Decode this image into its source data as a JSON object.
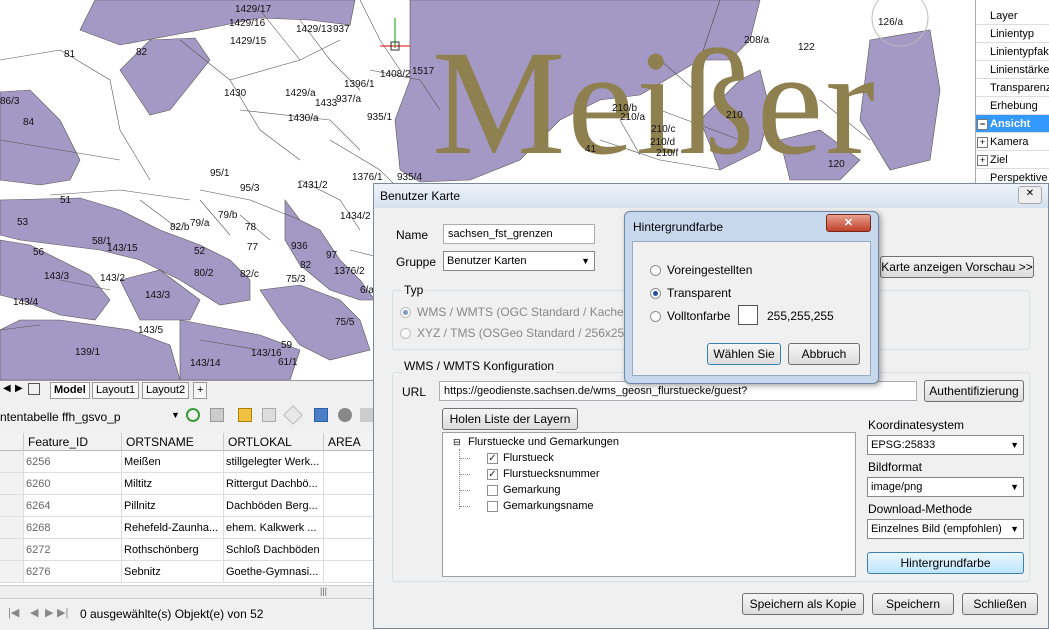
{
  "map": {
    "watermark": "Meißer",
    "parcels": [
      "1429/17",
      "1429/16",
      "1429/15",
      "937",
      "1429/13",
      "82",
      "81",
      "1430",
      "1408/2",
      "1517",
      "1396/1",
      "1433",
      "937/a",
      "935/1",
      "1430/a",
      "1429/a",
      "208/a",
      "122",
      "126/a",
      "210/b",
      "210/a",
      "210/c",
      "210/d",
      "210/f",
      "210",
      "120",
      "41",
      "86/3",
      "84",
      "95/1",
      "95/3",
      "1431/2",
      "1376/1",
      "935/4",
      "1434/2",
      "53",
      "56",
      "58/1",
      "51",
      "143/3",
      "143/4",
      "143/2",
      "143/3",
      "143/5",
      "139/1",
      "80/2",
      "82/c",
      "82/b",
      "79/a",
      "79/b",
      "78",
      "77",
      "936",
      "97",
      "52",
      "143/15",
      "143/14",
      "143/16",
      "61/1",
      "75/5",
      "75/3",
      "1376/2",
      "82",
      "6/a",
      "59"
    ]
  },
  "properties": {
    "items": [
      {
        "label": "Layer",
        "expander": ""
      },
      {
        "label": "Linientyp",
        "expander": ""
      },
      {
        "label": "Linientypfaktor",
        "expander": ""
      },
      {
        "label": "Linienstärke",
        "expander": ""
      },
      {
        "label": "Transparenz",
        "expander": ""
      },
      {
        "label": "Erhebung",
        "expander": ""
      },
      {
        "label": "Ansicht",
        "expander": "−",
        "selected": true
      },
      {
        "label": "Kamera",
        "expander": "+"
      },
      {
        "label": "Ziel",
        "expander": "+"
      },
      {
        "label": "Perspektive",
        "expander": ""
      }
    ]
  },
  "layout_tabs": {
    "nav": [
      "◀",
      "▶"
    ],
    "model": "Model",
    "layout1": "Layout1",
    "layout2": "Layout2",
    "add": "+"
  },
  "table_toolbar": {
    "label": "ntentabelle",
    "table_name": "ffh_gsvo_p"
  },
  "grid": {
    "columns": [
      "Feature_ID",
      "ORTSNAME",
      "ORTLOKAL",
      "AREA"
    ],
    "rows": [
      {
        "id": "6256",
        "name": "Meißen",
        "lokal": "stillgelegter Werk..."
      },
      {
        "id": "6260",
        "name": "Miltitz",
        "lokal": "Rittergut Dachbö..."
      },
      {
        "id": "6264",
        "name": "Pillnitz",
        "lokal": "Dachböden Berg..."
      },
      {
        "id": "6268",
        "name": "Rehefeld-Zaunha...",
        "lokal": "ehem. Kalkwerk ..."
      },
      {
        "id": "6272",
        "name": "Rothschönberg",
        "lokal": "Schloß Dachböden"
      },
      {
        "id": "6276",
        "name": "Sebnitz",
        "lokal": "Goethe-Gymnasi..."
      }
    ]
  },
  "status": {
    "text": "0 ausgewählte(s) Objekt(e) von 52"
  },
  "dialog": {
    "title": "Benutzer Karte",
    "name_label": "Name",
    "name_value": "sachsen_fst_grenzen",
    "gruppe_label": "Gruppe",
    "gruppe_value": "Benutzer Karten",
    "preview_button": "Karte anzeigen Vorschau >>",
    "typ_label": "Typ",
    "typ_wms": "WMS / WMTS (OGC Standard / Kacheln a",
    "typ_xyz": "XYZ / TMS (OSGeo Standard / 256x256 K",
    "wms_section": "WMS / WMTS Konfiguration",
    "url_label": "URL",
    "url_value": "https://geodienste.sachsen.de/wms_geosn_flurstuecke/guest?",
    "auth_button": "Authentifizierung",
    "holen_button": "Holen Liste der Layern",
    "tree": {
      "root": "Flurstuecke und Gemarkungen",
      "children": [
        {
          "label": "Flurstueck",
          "checked": true
        },
        {
          "label": "Flurstuecksnummer",
          "checked": true
        },
        {
          "label": "Gemarkung",
          "checked": false
        },
        {
          "label": "Gemarkungsname",
          "checked": false
        }
      ]
    },
    "crs_label": "Koordinatesystem",
    "crs_value": "EPSG:25833",
    "format_label": "Bildformat",
    "format_value": "image/png",
    "download_label": "Download-Methode",
    "download_value": "Einzelnes Bild (empfohlen)",
    "bg_button": "Hintergrundfarbe",
    "save_copy_button": "Speichern als Kopie",
    "save_button": "Speichern",
    "close_button": "Schließen"
  },
  "bg_dialog": {
    "title": "Hintergrundfarbe",
    "opt_default": "Voreingestellten",
    "opt_transparent": "Transparent",
    "opt_solid": "Volltonfarbe",
    "color_value": "255,255,255",
    "choose_button": "Wählen Sie",
    "cancel_button": "Abbruch",
    "close_glyph": "✕"
  },
  "colors": {
    "parcel_fill": "#a399c4",
    "watermark": "#8f8050",
    "selection": "#3399ff"
  }
}
